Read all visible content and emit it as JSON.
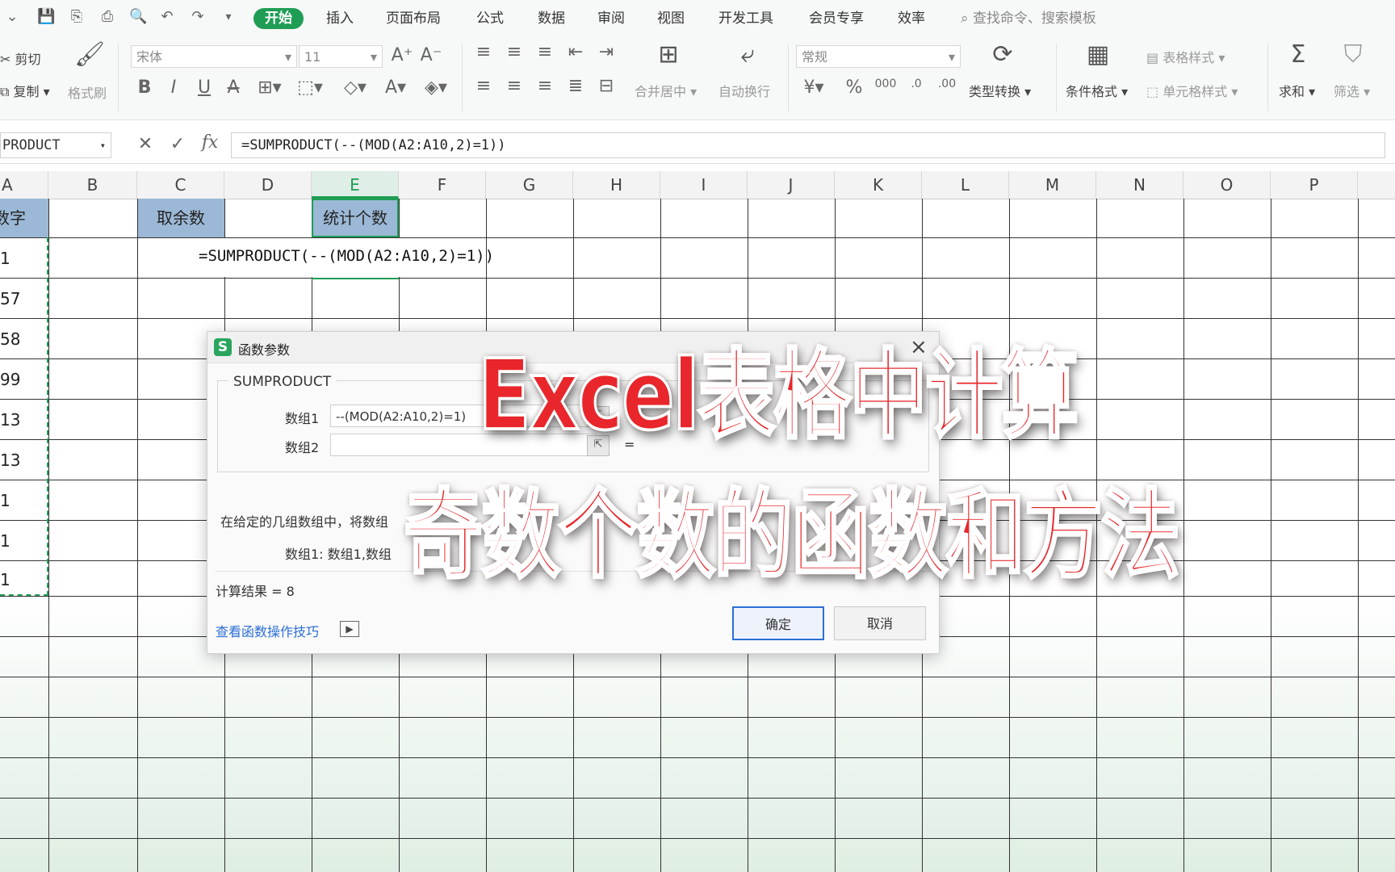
{
  "menubar": {
    "items": [
      "开始",
      "插入",
      "页面布局",
      "公式",
      "数据",
      "审阅",
      "视图",
      "开发工具",
      "会员专享",
      "效率"
    ],
    "search_placeholder": "查找命令、搜索模板"
  },
  "ribbon": {
    "cut": "剪切",
    "copy": "复制",
    "format_painter": "格式刷",
    "font_name": "宋体",
    "font_size": "11",
    "number_format": "常规",
    "merge_center": "合并居中",
    "wrap_text": "自动换行",
    "type_convert": "类型转换",
    "conditional_format": "条件格式",
    "table_style": "表格样式",
    "cell_style": "单元格样式",
    "sum": "求和",
    "filter": "筛选"
  },
  "formula_bar": {
    "name_box": "PRODUCT",
    "fx_label": "fx",
    "formula": "=SUMPRODUCT(--(MOD(A2:A10,2)=1))"
  },
  "grid": {
    "columns": [
      "A",
      "B",
      "C",
      "D",
      "E",
      "F",
      "G",
      "H",
      "I",
      "J",
      "K",
      "L",
      "M",
      "N",
      "O",
      "P"
    ],
    "selected_column": "E",
    "header_a": "数字",
    "header_c": "取余数",
    "header_e": "统计个数",
    "col_a_values": [
      "1",
      "57",
      "58",
      "99",
      "13",
      "13",
      "1",
      "1",
      "1"
    ],
    "cell_formula": "=SUMPRODUCT(--(MOD(A2:A10,2)=1))"
  },
  "dialog": {
    "title": "函数参数",
    "function_name": "SUMPRODUCT",
    "arg1_label": "数组1",
    "arg1_value": "--(MOD(A2:A10,2)=1)",
    "arg2_label": "数组2",
    "equals": "=",
    "description": "在给定的几组数组中，将数组",
    "arg_description": "数组1:  数组1,数组",
    "result": "计算结果 = 8",
    "help_link": "查看函数操作技巧",
    "ok": "确定",
    "cancel": "取消"
  },
  "overlay": {
    "line1": "Excel表格中计算",
    "line2": "奇数个数的函数和方法",
    "color": "#e8262b"
  }
}
